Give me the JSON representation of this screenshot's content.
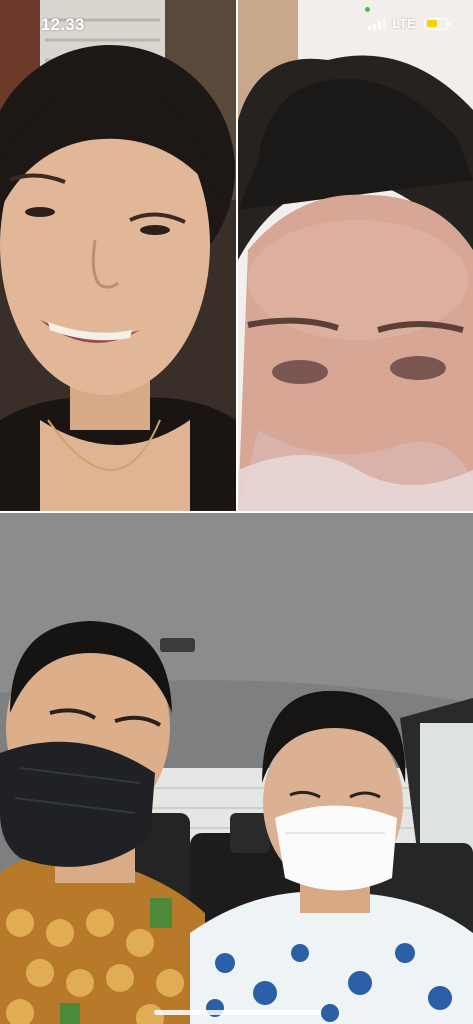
{
  "status_bar": {
    "time": "12.33",
    "network": "LTE",
    "battery_level": 0.6,
    "battery_color": "#f5d100",
    "camera_indicator_color": "#2ecc40"
  },
  "participants": [
    {
      "role": "remote-participant-1"
    },
    {
      "role": "remote-participant-2"
    },
    {
      "role": "self-view"
    }
  ]
}
